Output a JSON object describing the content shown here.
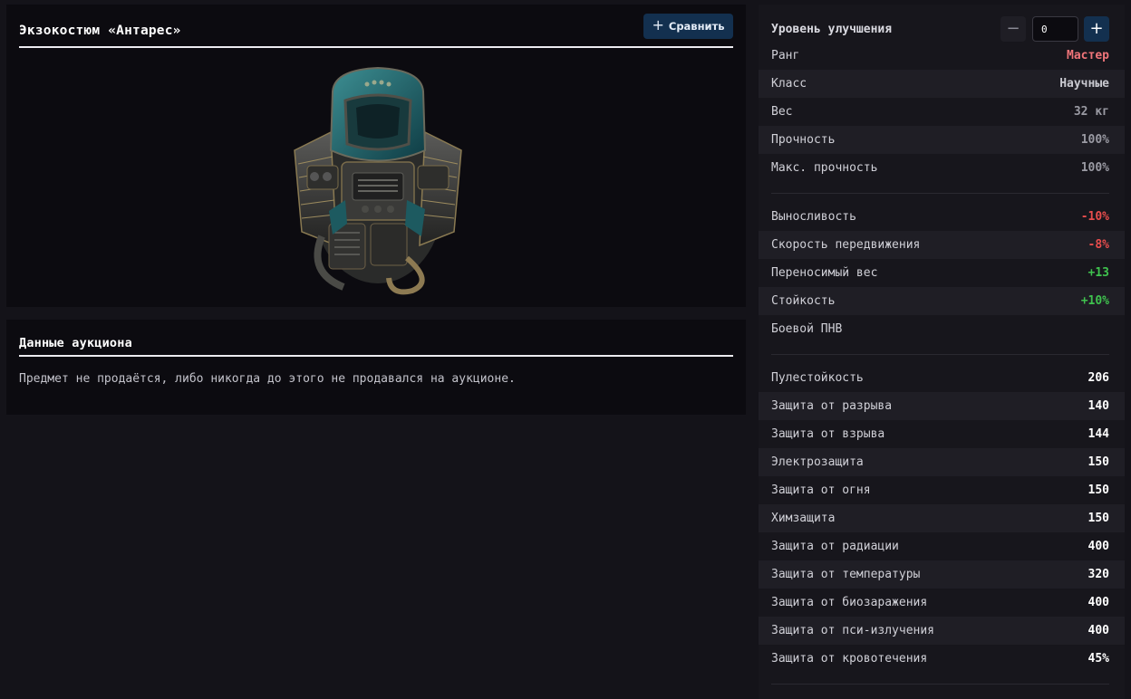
{
  "item": {
    "title": "Экзокостюм «Антарес»",
    "compare_label": "Сравнить",
    "image_icon": "exosuit-image"
  },
  "auction": {
    "title": "Данные аукциона",
    "text": "Предмет не продаётся, либо никогда до этого не продавался на аукционе."
  },
  "upgrade": {
    "label": "Уровень улучшения",
    "value": "0",
    "minus_icon": "minus-icon",
    "plus_icon": "plus-icon"
  },
  "colors": {
    "accent": "#13304f",
    "rank": "#f0757a",
    "negative": "#e84d4d",
    "positive": "#3fc24e",
    "muted": "#9a9aa3",
    "light": "#c8c8cf",
    "white": "#ffffff"
  },
  "stats": {
    "basic": [
      {
        "label": "Ранг",
        "value": "Мастер",
        "tone": "rank"
      },
      {
        "label": "Класс",
        "value": "Научные",
        "tone": "light"
      },
      {
        "label": "Вес",
        "value": "32 кг",
        "tone": "muted"
      },
      {
        "label": "Прочность",
        "value": "100%",
        "tone": "muted"
      },
      {
        "label": "Макс. прочность",
        "value": "100%",
        "tone": "muted"
      }
    ],
    "bonuses": [
      {
        "label": "Выносливость",
        "value": "-10%",
        "tone": "negative"
      },
      {
        "label": "Скорость передвижения",
        "value": "-8%",
        "tone": "negative"
      },
      {
        "label": "Переносимый вес",
        "value": "+13",
        "tone": "positive"
      },
      {
        "label": "Стойкость",
        "value": "+10%",
        "tone": "positive"
      },
      {
        "label": "Боевой ПНВ",
        "value": "",
        "tone": "light"
      }
    ],
    "protection": [
      {
        "label": "Пулестойкость",
        "value": "206",
        "tone": "white"
      },
      {
        "label": "Защита от разрыва",
        "value": "140",
        "tone": "white"
      },
      {
        "label": "Защита от взрыва",
        "value": "144",
        "tone": "white"
      },
      {
        "label": "Электрозащита",
        "value": "150",
        "tone": "white"
      },
      {
        "label": "Защита от огня",
        "value": "150",
        "tone": "white"
      },
      {
        "label": "Химзащита",
        "value": "150",
        "tone": "white"
      },
      {
        "label": "Защита от радиации",
        "value": "400",
        "tone": "white"
      },
      {
        "label": "Защита от температуры",
        "value": "320",
        "tone": "white"
      },
      {
        "label": "Защита от биозаражения",
        "value": "400",
        "tone": "white"
      },
      {
        "label": "Защита от пси-излучения",
        "value": "400",
        "tone": "white"
      },
      {
        "label": "Защита от кровотечения",
        "value": "45%",
        "tone": "white"
      }
    ]
  }
}
